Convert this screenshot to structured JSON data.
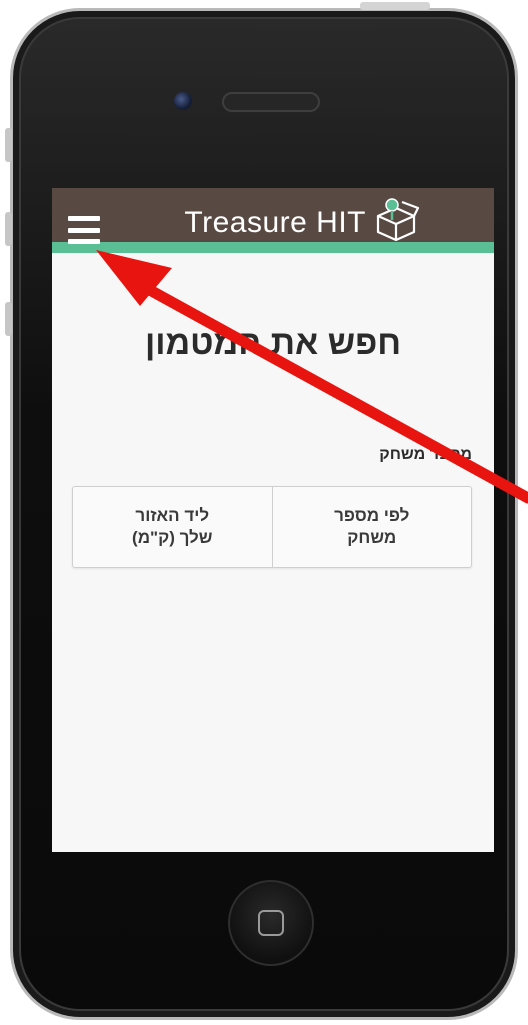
{
  "app": {
    "title": "Treasure HIT",
    "logo_icon": "treasure-box-icon",
    "menu_icon": "hamburger-menu-icon",
    "header_color": "#584a43",
    "accent_color": "#5bbf95"
  },
  "main": {
    "page_title": "חפש את המטמון",
    "section_label": "מספר משחק",
    "buttons": [
      {
        "label": "ליד האזור\nשלך (ק\"מ)"
      },
      {
        "label": "לפי מספר\nמשחק"
      }
    ]
  },
  "annotation": {
    "type": "arrow",
    "color": "#e8140f",
    "points_to": "hamburger-menu-icon"
  }
}
